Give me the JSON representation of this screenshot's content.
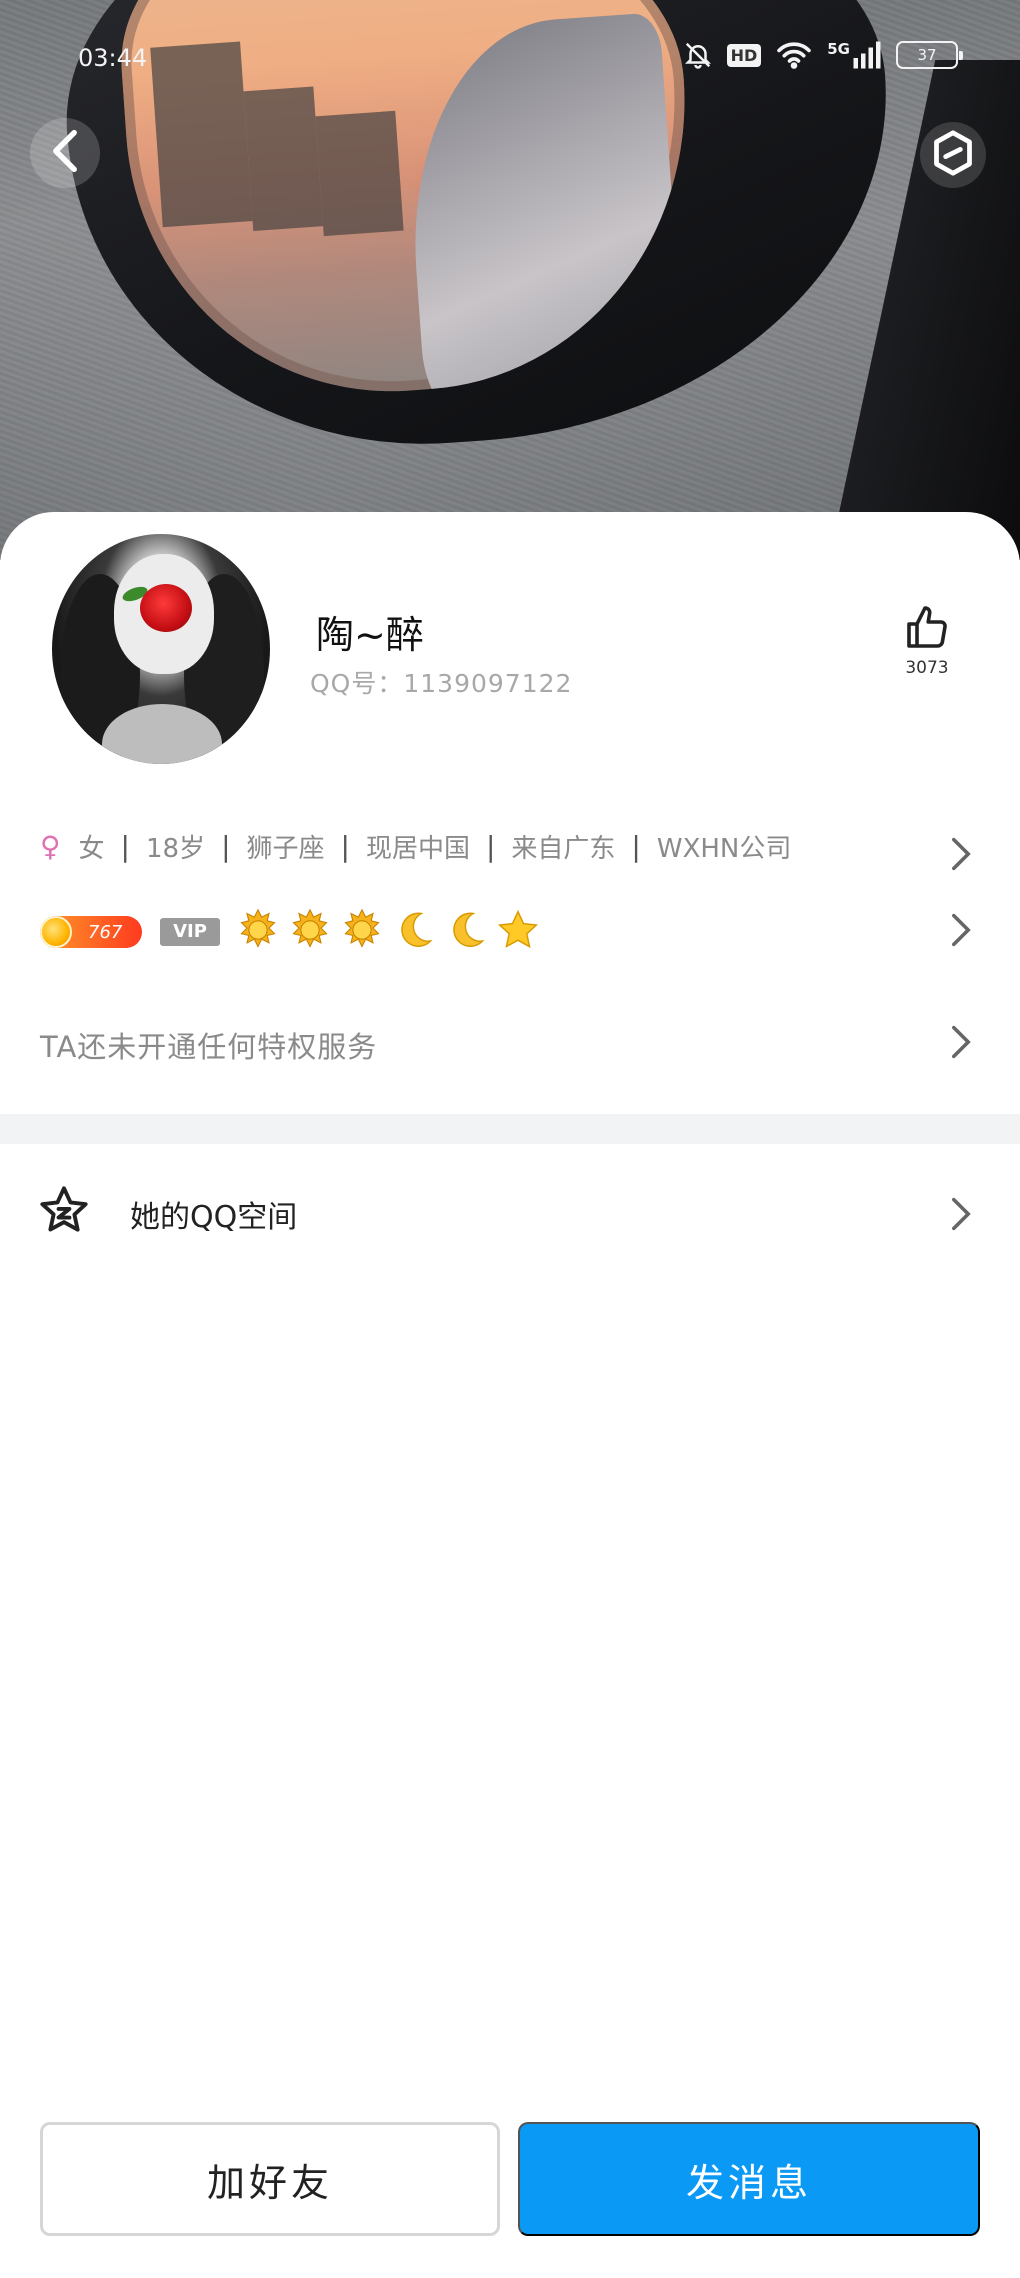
{
  "status_bar": {
    "time": "03:44",
    "network": "5G",
    "hd": "HD",
    "battery": "37",
    "icons": [
      "bell-muted-icon",
      "hd-icon",
      "wifi-icon",
      "signal-5g-icon",
      "battery-icon"
    ]
  },
  "header": {
    "back_icon": "chevron-left-icon",
    "settings_icon": "hexagon-icon"
  },
  "profile": {
    "name": "陶~醉",
    "qq_number": "QQ号：1139097122",
    "likes": "3073",
    "like_icon": "thumbs-up-icon"
  },
  "info": {
    "gender_icon": "female-icon",
    "gender": "女",
    "age": "18岁",
    "zodiac": "狮子座",
    "location": "现居中国",
    "hometown": "来自广东",
    "company": "WXHN公司"
  },
  "vip": {
    "level": "767",
    "badge": "VIP",
    "badges": [
      "sun-icon",
      "sun-icon",
      "sun-icon",
      "moon-icon",
      "moon-icon",
      "star-icon"
    ]
  },
  "privilege": {
    "text": "TA还未开通任何特权服务"
  },
  "qzone": {
    "text": "她的QQ空间",
    "icon": "qzone-star-icon"
  },
  "actions": {
    "add_friend": "加好友",
    "send_message": "发消息"
  },
  "colors": {
    "accent": "#0a9af5",
    "female": "#e071b3",
    "muted_text": "#8a8a8a"
  }
}
